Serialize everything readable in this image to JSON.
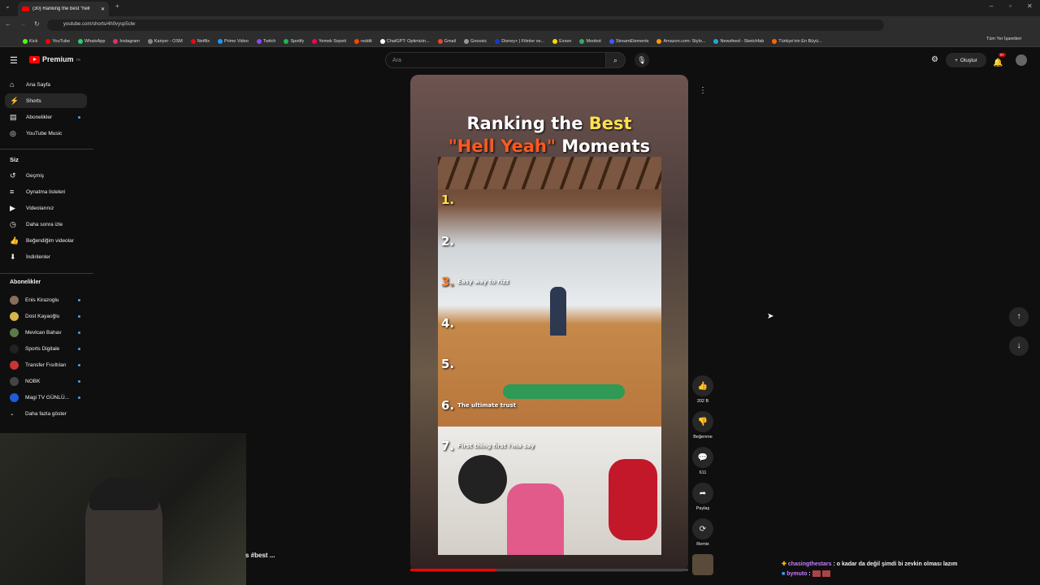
{
  "browser": {
    "tab_title": "(30) Ranking the best \"hell",
    "url": "youtube.com/shorts/4h0vysp5clw",
    "bookmarks": [
      {
        "label": "Kick",
        "color": "#53fc18"
      },
      {
        "label": "YouTube",
        "color": "#ff0000"
      },
      {
        "label": "WhatsApp",
        "color": "#25d366"
      },
      {
        "label": "Instagram",
        "color": "#e1306c"
      },
      {
        "label": "Kariyer - OSM",
        "color": "#888888"
      },
      {
        "label": "Netflix",
        "color": "#e50914"
      },
      {
        "label": "Prime Video",
        "color": "#1a98ff"
      },
      {
        "label": "Twitch",
        "color": "#9146ff"
      },
      {
        "label": "Spotify",
        "color": "#1db954"
      },
      {
        "label": "Yemek Sepeti",
        "color": "#fa0050"
      },
      {
        "label": "reddit",
        "color": "#ff4500"
      },
      {
        "label": "ChatGPT: Optimizin...",
        "color": "#ffffff"
      },
      {
        "label": "Gmail",
        "color": "#ea4335"
      },
      {
        "label": "Gnoosic",
        "color": "#999999"
      },
      {
        "label": "Disney+ | Filmler ve...",
        "color": "#113ccf"
      },
      {
        "label": "Exxen",
        "color": "#ffd700"
      },
      {
        "label": "Moobot",
        "color": "#33aa66"
      },
      {
        "label": "StreamElements",
        "color": "#3d5afe"
      },
      {
        "label": "Amazon.com: Stylo...",
        "color": "#ff9900"
      },
      {
        "label": "Newsfeed - Sketchfab",
        "color": "#1caad9"
      },
      {
        "label": "Türkiye'nin En Büyü...",
        "color": "#ff6600"
      }
    ],
    "all_bookmarks": "Tüm Yer İşaretleri"
  },
  "header": {
    "logo": "Premium",
    "logo_badge": "TR",
    "search_placeholder": "Ara",
    "create_label": "Oluştur",
    "notif_count": "9+"
  },
  "sidebar": {
    "main": [
      {
        "label": "Ana Sayfa",
        "icon": "home-icon"
      },
      {
        "label": "Shorts",
        "icon": "shorts-icon",
        "active": true
      },
      {
        "label": "Abonelikler",
        "icon": "subscriptions-icon"
      },
      {
        "label": "YouTube Music",
        "icon": "music-icon"
      }
    ],
    "you_header": "Siz",
    "you": [
      {
        "label": "Geçmiş",
        "icon": "history-icon"
      },
      {
        "label": "Oynatma listeleri",
        "icon": "playlists-icon"
      },
      {
        "label": "Videolarınız",
        "icon": "your-videos-icon"
      },
      {
        "label": "Daha sonra izle",
        "icon": "clock-icon"
      },
      {
        "label": "Beğendiğim videolar",
        "icon": "like-icon"
      },
      {
        "label": "İndirilenler",
        "icon": "download-icon"
      }
    ],
    "subs_header": "Abonelikler",
    "subs": [
      {
        "label": "Enis Kirazoglu",
        "color": "#8a6d5b"
      },
      {
        "label": "Dost Kayaoğlu",
        "color": "#d8b24a"
      },
      {
        "label": "Mevlcan Bahav",
        "color": "#5a7a4a"
      },
      {
        "label": "Sports Digitale",
        "color": "#222222"
      },
      {
        "label": "Transfer Fısıltıları",
        "color": "#c33"
      },
      {
        "label": "NOBK",
        "color": "#444"
      },
      {
        "label": "Magi TV GÜNLÜ...",
        "color": "#1e5bd8"
      }
    ],
    "show_more": "Daha fazla göster"
  },
  "video": {
    "title_line1_a": "Ranking the ",
    "title_line1_b": "Best",
    "title_line2_a": "\"Hell Yeah\"",
    "title_line2_b": " Moments",
    "ranks": [
      {
        "num": "1.",
        "caption": ""
      },
      {
        "num": "2.",
        "caption": ""
      },
      {
        "num": "3.",
        "caption": "Easy way to rizz"
      },
      {
        "num": "4.",
        "caption": ""
      },
      {
        "num": "5.",
        "caption": ""
      },
      {
        "num": "6.",
        "caption": "The ultimate trust"
      },
      {
        "num": "7.",
        "caption": "First thing first i'ma say"
      }
    ],
    "progress_fraction": 0.31
  },
  "actions": {
    "like_count": "202 B",
    "dislike_label": "Beğenme",
    "comments_count": "611",
    "share_label": "Paylaş",
    "remix_label": "Remix"
  },
  "overlay": {
    "hashtag": "s #best ..."
  },
  "chat": [
    {
      "user": "chasingthestars",
      "message": ": o kadar da değil şimdi bi zevkin olması lazım"
    },
    {
      "user": "bymuto",
      "message": ":"
    }
  ]
}
